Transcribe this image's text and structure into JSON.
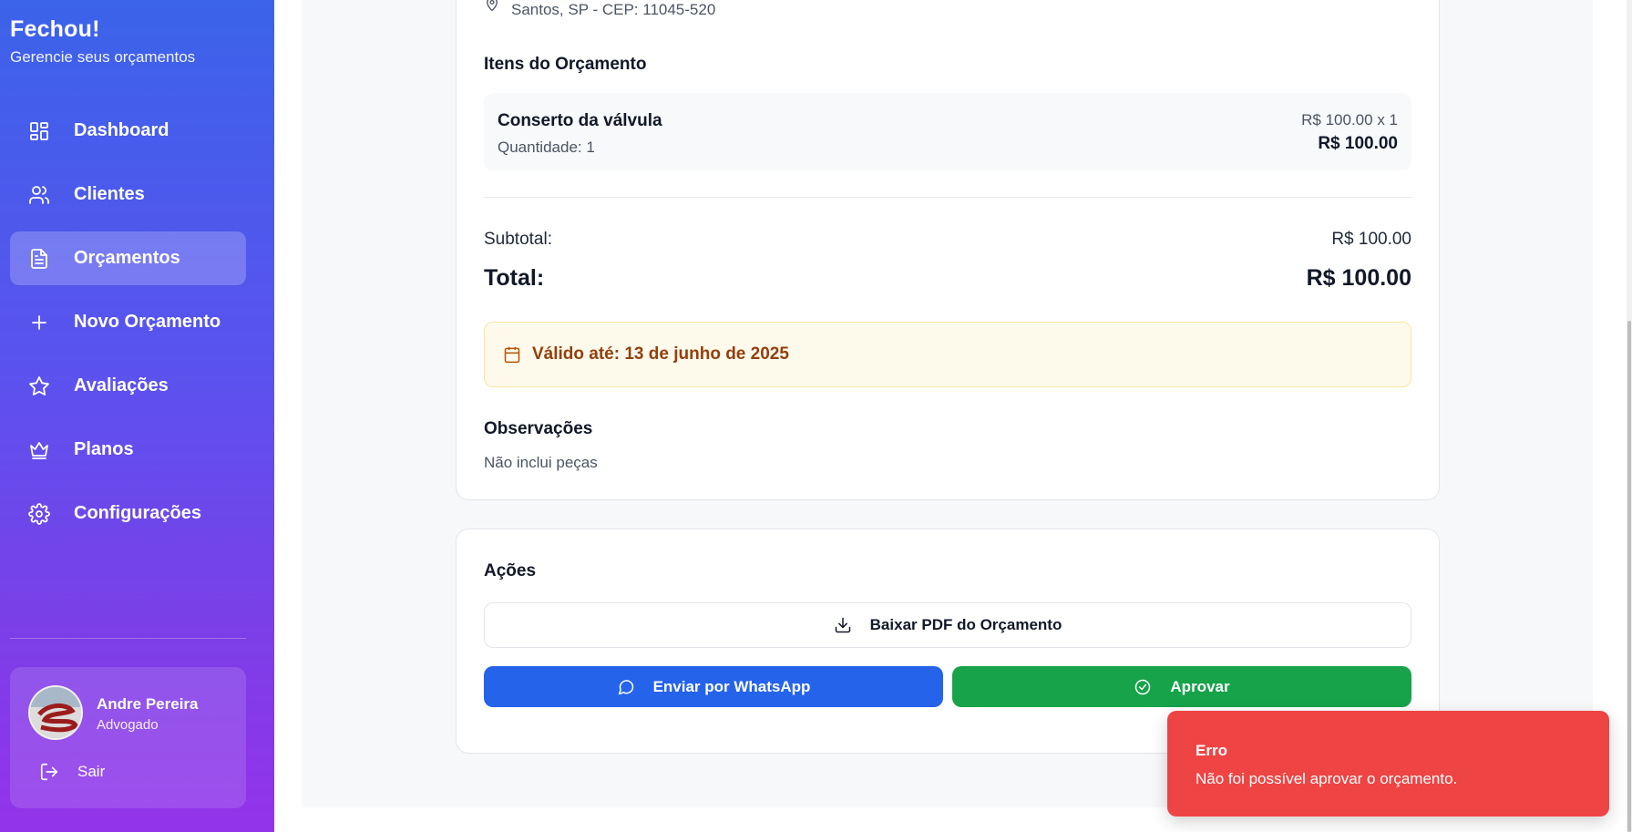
{
  "app": {
    "title": "Fechou!",
    "subtitle": "Gerencie seus orçamentos"
  },
  "sidebar": {
    "items": [
      {
        "label": "Dashboard",
        "icon": "dashboard-icon",
        "active": false
      },
      {
        "label": "Clientes",
        "icon": "users-icon",
        "active": false
      },
      {
        "label": "Orçamentos",
        "icon": "document-icon",
        "active": true
      },
      {
        "label": "Novo Orçamento",
        "icon": "plus-icon",
        "active": false
      },
      {
        "label": "Avaliações",
        "icon": "star-icon",
        "active": false
      },
      {
        "label": "Planos",
        "icon": "crown-icon",
        "active": false
      },
      {
        "label": "Configurações",
        "icon": "gear-icon",
        "active": false
      }
    ],
    "user": {
      "name": "Andre Pereira",
      "role": "Advogado",
      "logout_label": "Sair"
    }
  },
  "quote": {
    "address_line": "Santos, SP - CEP: 11045-520",
    "items_title": "Itens do Orçamento",
    "items": [
      {
        "name": "Conserto da válvula",
        "quantity_label": "Quantidade: 1",
        "unit_line": "R$ 100.00 x 1",
        "total": "R$ 100.00"
      }
    ],
    "subtotal_label": "Subtotal:",
    "subtotal_value": "R$ 100.00",
    "total_label": "Total:",
    "total_value": "R$ 100.00",
    "validity": "Válido até: 13 de junho de 2025",
    "notes_title": "Observações",
    "notes_text": "Não inclui peças"
  },
  "actions": {
    "title": "Ações",
    "pdf_label": "Baixar PDF do Orçamento",
    "whatsapp_label": "Enviar por WhatsApp",
    "approve_label": "Aprovar"
  },
  "toast": {
    "title": "Erro",
    "message": "Não foi possível aprovar o orçamento."
  },
  "colors": {
    "sidebar_top": "#3b63ea",
    "sidebar_bottom": "#9333ea",
    "whatsapp_button": "#2563eb",
    "approve_button": "#16a34a",
    "error_toast": "#ef4444",
    "validity_bg": "#fefaeb"
  }
}
